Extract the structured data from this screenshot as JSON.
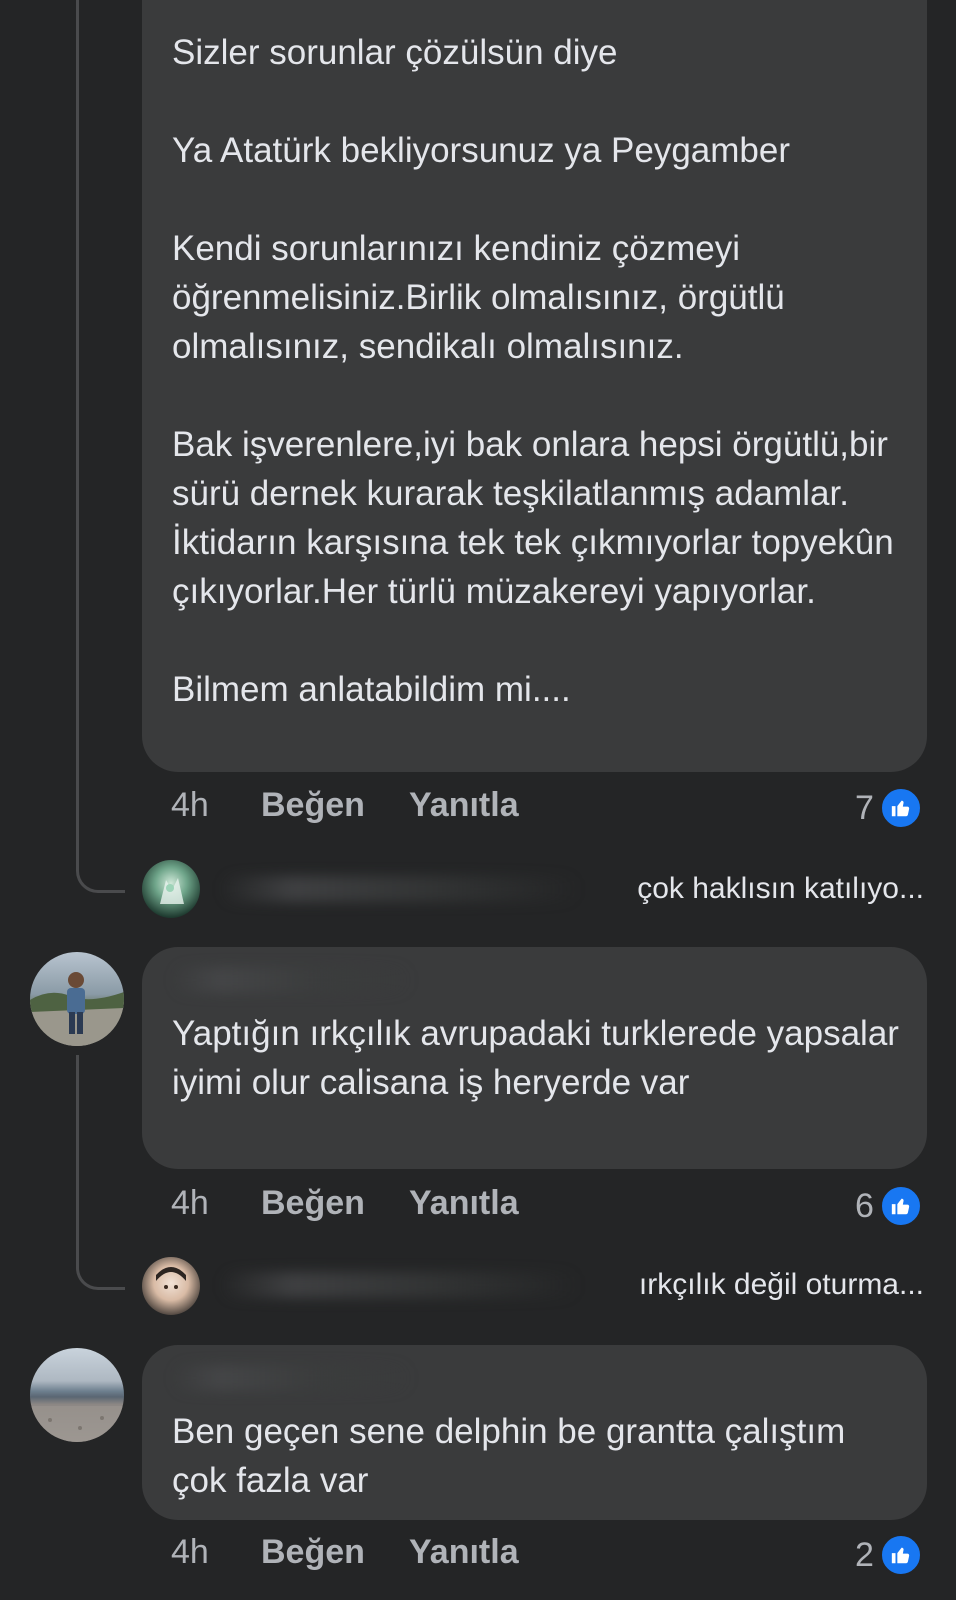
{
  "comments": [
    {
      "text": "Sizler sorunlar çözülsün diye\n\nYa Atatürk bekliyorsunuz ya Peygamber\n\nKendi sorunlarınızı kendiniz çözmeyi öğrenmelisiniz.Birlik olmalısınız, örgütlü olmalısınız, sendikalı olmalısınız.\n\nBak işverenlere,iyi bak onlara hepsi örgütlü,bir sürü dernek kurarak teşkilatlanmış adamlar. İktidarın karşısına tek tek çıkmıyorlar topyekûn çıkıyorlar.Her türlü müzakereyi yapıyorlar.\n\nBilmem anlatabildim mi....",
      "time": "4h",
      "like_label": "Beğen",
      "reply_label": "Yanıtla",
      "reaction_count": "7",
      "reply_preview": "çok haklısın katılıyo..."
    },
    {
      "text": "Yaptığın ırkçılık avrupadaki turklerede yapsalar iyimi olur calisana iş heryerde var",
      "time": "4h",
      "like_label": "Beğen",
      "reply_label": "Yanıtla",
      "reaction_count": "6",
      "reply_preview": "ırkçılık değil oturma..."
    },
    {
      "text": "Ben geçen sene delphin be grantta çalıştım çok fazla var",
      "time": "4h",
      "like_label": "Beğen",
      "reply_label": "Yanıtla",
      "reaction_count": "2"
    }
  ],
  "colors": {
    "background": "#242526",
    "bubble": "#3a3b3c",
    "text": "#e4e6eb",
    "secondary_text": "#b0b3b8",
    "like_blue": "#1877f2"
  },
  "icons": {
    "reaction": "thumbs-up-icon"
  }
}
